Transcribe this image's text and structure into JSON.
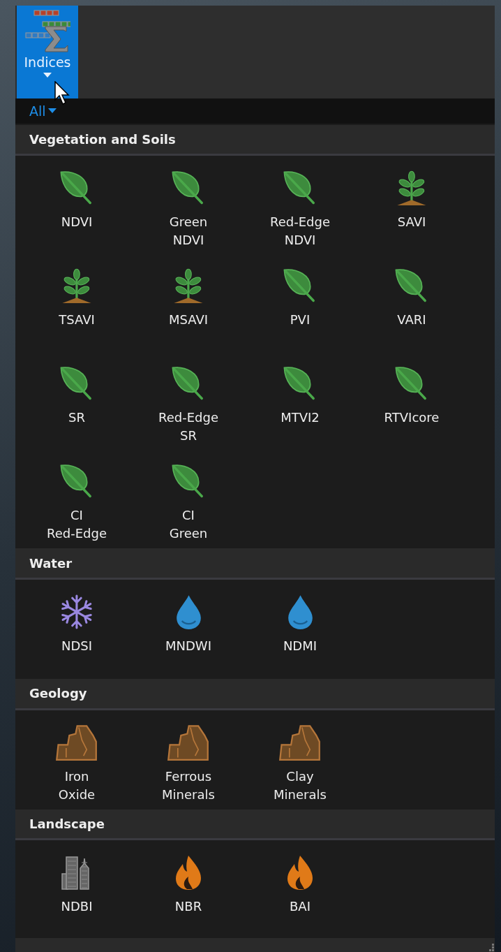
{
  "ribbon": {
    "button": {
      "label": "Indices",
      "selected": true
    }
  },
  "filter": {
    "label": "All"
  },
  "sections": [
    {
      "title": "Vegetation and Soils",
      "items": [
        {
          "label": "NDVI",
          "kind": "leaf"
        },
        {
          "label": "Green\nNDVI",
          "kind": "leaf"
        },
        {
          "label": "Red-Edge\nNDVI",
          "kind": "leaf"
        },
        {
          "label": "SAVI",
          "kind": "sprout"
        },
        {
          "label": "TSAVI",
          "kind": "sprout"
        },
        {
          "label": "MSAVI",
          "kind": "sprout"
        },
        {
          "label": "PVI",
          "kind": "leaf"
        },
        {
          "label": "VARI",
          "kind": "leaf"
        },
        {
          "label": "SR",
          "kind": "leaf"
        },
        {
          "label": "Red-Edge\nSR",
          "kind": "leaf"
        },
        {
          "label": "MTVI2",
          "kind": "leaf"
        },
        {
          "label": "RTVIcore",
          "kind": "leaf"
        },
        {
          "label": "CI\nRed-Edge",
          "kind": "leaf"
        },
        {
          "label": "CI\nGreen",
          "kind": "leaf"
        }
      ]
    },
    {
      "title": "Water",
      "items": [
        {
          "label": "NDSI",
          "kind": "snowflake"
        },
        {
          "label": "MNDWI",
          "kind": "drop"
        },
        {
          "label": "NDMI",
          "kind": "drop"
        }
      ]
    },
    {
      "title": "Geology",
      "items": [
        {
          "label": "Iron\nOxide",
          "kind": "rock"
        },
        {
          "label": "Ferrous\nMinerals",
          "kind": "rock"
        },
        {
          "label": "Clay\nMinerals",
          "kind": "rock"
        }
      ]
    },
    {
      "title": "Landscape",
      "items": [
        {
          "label": "NDBI",
          "kind": "buildings"
        },
        {
          "label": "NBR",
          "kind": "fire"
        },
        {
          "label": "BAI",
          "kind": "fire"
        }
      ]
    }
  ]
}
